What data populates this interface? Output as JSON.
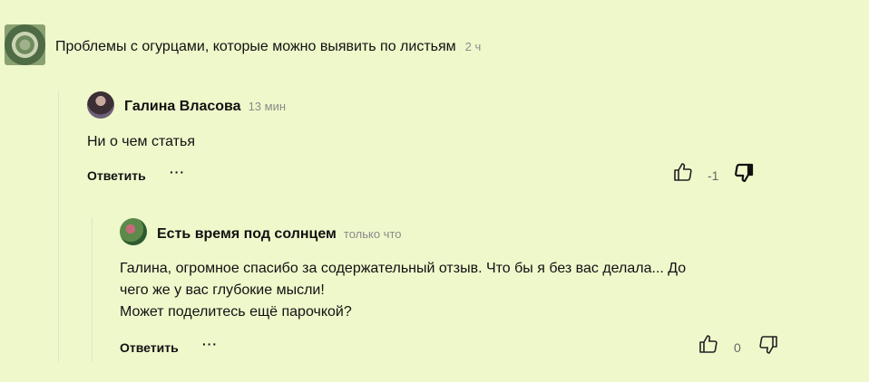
{
  "article": {
    "title": "Проблемы с огурцами, которые можно выявить по листьям",
    "time": "2 ч",
    "thumbnail": "leaf-thumbnail"
  },
  "comments": [
    {
      "author": "Галина Власова",
      "time": "13 мин",
      "lines": [
        "Ни о чем статья"
      ],
      "reply_label": "Ответить",
      "more_label": "···",
      "score": "-1",
      "disliked": true
    },
    {
      "author": "Есть время под солнцем",
      "time": "только что",
      "lines": [
        "Галина, огромное спасибо за содержательный отзыв. Что бы я без вас делала... До",
        "чего же у вас глубокие мысли!",
        "Может поделитесь ещё парочкой?"
      ],
      "reply_label": "Ответить",
      "more_label": "···",
      "score": "0",
      "disliked": false
    }
  ],
  "colors": {
    "background": "#eff8cb",
    "muted": "#8a8a8a",
    "text": "#111111"
  }
}
